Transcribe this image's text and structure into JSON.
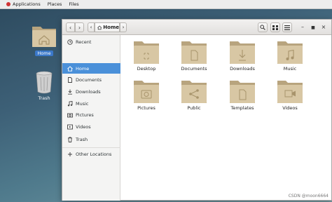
{
  "topbar": {
    "menus": [
      "Applications",
      "Places",
      "Files"
    ]
  },
  "desktop": {
    "home_label": "Home",
    "trash_label": "Trash"
  },
  "window": {
    "crumb_label": "Home"
  },
  "sidebar": {
    "items": [
      {
        "label": "Recent",
        "icon": "clock-icon"
      },
      {
        "label": "Home",
        "icon": "home-icon"
      },
      {
        "label": "Documents",
        "icon": "document-icon"
      },
      {
        "label": "Downloads",
        "icon": "download-icon"
      },
      {
        "label": "Music",
        "icon": "music-icon"
      },
      {
        "label": "Pictures",
        "icon": "camera-icon"
      },
      {
        "label": "Videos",
        "icon": "video-icon"
      },
      {
        "label": "Trash",
        "icon": "trash-icon"
      },
      {
        "label": "Other Locations",
        "icon": "plus-icon"
      }
    ]
  },
  "folders": [
    {
      "label": "Desktop",
      "icon": "desktop-folder-icon"
    },
    {
      "label": "Documents",
      "icon": "documents-folder-icon"
    },
    {
      "label": "Downloads",
      "icon": "downloads-folder-icon"
    },
    {
      "label": "Music",
      "icon": "music-folder-icon"
    },
    {
      "label": "Pictures",
      "icon": "pictures-folder-icon"
    },
    {
      "label": "Public",
      "icon": "public-folder-icon"
    },
    {
      "label": "Templates",
      "icon": "templates-folder-icon"
    },
    {
      "label": "Videos",
      "icon": "videos-folder-icon"
    }
  ],
  "watermark": "CSDN @moon6664",
  "colors": {
    "accent": "#4a90d9",
    "folder": "#d8c7a4",
    "folder_dark": "#b8a47e"
  }
}
